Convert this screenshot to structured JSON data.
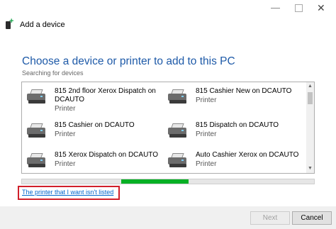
{
  "window": {
    "title": "Add a device",
    "controls": {
      "minimize": "—",
      "close": "✕"
    }
  },
  "main": {
    "heading": "Choose a device or printer to add to this PC",
    "status": "Searching for devices"
  },
  "devices": [
    {
      "name": "815 2nd floor Xerox Dispatch on DCAUTO",
      "type": "Printer",
      "icon": "printer-icon"
    },
    {
      "name": "815 Cashier New on DCAUTO",
      "type": "Printer",
      "icon": "printer-icon"
    },
    {
      "name": "815 Cashier on DCAUTO",
      "type": "Printer",
      "icon": "printer-icon"
    },
    {
      "name": "815 Dispatch on DCAUTO",
      "type": "Printer",
      "icon": "printer-icon"
    },
    {
      "name": "815 Xerox Dispatch on DCAUTO",
      "type": "Printer",
      "icon": "printer-icon"
    },
    {
      "name": "Auto Cashier Xerox on DCAUTO",
      "type": "Printer",
      "icon": "printer-icon"
    }
  ],
  "scrollbar": {
    "up": "▲",
    "down": "▼"
  },
  "progress": {
    "style": "marquee",
    "segment_start": 0.34,
    "segment_end": 0.57,
    "color": "#06b025"
  },
  "link": {
    "label": "The printer that I want isn't listed",
    "highlight_color": "#d01f2a"
  },
  "buttons": {
    "next": "Next",
    "cancel": "Cancel"
  },
  "colors": {
    "heading": "#1e5aa8",
    "link": "#0066cc"
  }
}
